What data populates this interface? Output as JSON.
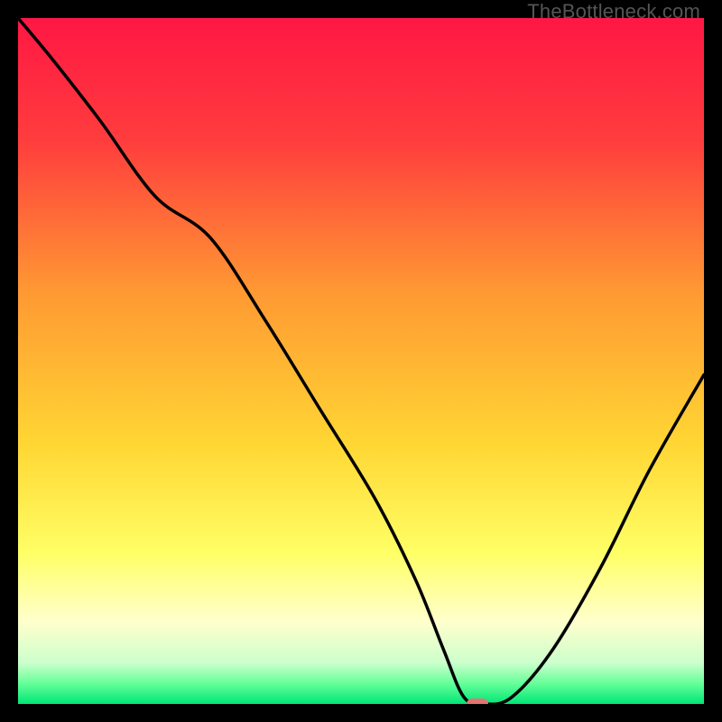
{
  "attribution": "TheBottleneck.com",
  "chart_data": {
    "type": "line",
    "title": "",
    "xlabel": "",
    "ylabel": "",
    "xlim": [
      0,
      100
    ],
    "ylim": [
      0,
      100
    ],
    "series": [
      {
        "name": "bottleneck-curve",
        "x": [
          0,
          5,
          12,
          20,
          28,
          36,
          44,
          52,
          58,
          62,
          65,
          68,
          72,
          78,
          85,
          92,
          100
        ],
        "values": [
          100,
          94,
          85,
          74,
          68,
          56,
          43,
          30,
          18,
          8,
          1,
          0,
          1,
          8,
          20,
          34,
          48
        ]
      }
    ],
    "marker": {
      "x": 67,
      "y": 0
    }
  },
  "colors": {
    "gradient_stops": [
      {
        "stop": 0.0,
        "hex": "#ff1744"
      },
      {
        "stop": 0.18,
        "hex": "#ff3d3d"
      },
      {
        "stop": 0.4,
        "hex": "#ff9933"
      },
      {
        "stop": 0.62,
        "hex": "#ffd633"
      },
      {
        "stop": 0.78,
        "hex": "#ffff66"
      },
      {
        "stop": 0.88,
        "hex": "#ffffcc"
      },
      {
        "stop": 0.94,
        "hex": "#ccffcc"
      },
      {
        "stop": 0.97,
        "hex": "#66ff99"
      },
      {
        "stop": 1.0,
        "hex": "#00e676"
      }
    ],
    "curve": "#000000",
    "marker": "#e57373",
    "frame": "#000000"
  }
}
